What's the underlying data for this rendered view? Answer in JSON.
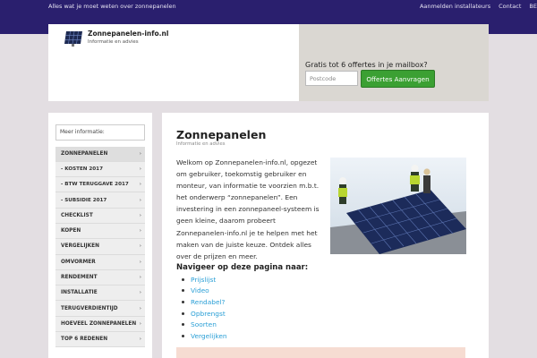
{
  "topbar": {
    "tagline": "Alles wat je moet weten over zonnepanelen",
    "links": [
      "Aanmelden installateurs",
      "Contact",
      "BE"
    ]
  },
  "header": {
    "site_title": "Zonnepanelen-info.nl",
    "site_subtitle": "Informatie en advies",
    "logo_icon": "solar-panel-icon",
    "cta_text": "Gratis tot 6 offertes in je mailbox?",
    "postcode_placeholder": "Postcode",
    "cta_button": "Offertes Aanvragen"
  },
  "sidebar": {
    "search_placeholder": "Meer informatie:",
    "items": [
      {
        "label": "ZONNEPANELEN"
      },
      {
        "label": "- KOSTEN 2017"
      },
      {
        "label": "- BTW TERUGGAVE 2017"
      },
      {
        "label": "- SUBSIDIE 2017"
      },
      {
        "label": "CHECKLIST"
      },
      {
        "label": "KOPEN"
      },
      {
        "label": "VERGELIJKEN"
      },
      {
        "label": "OMVORMER"
      },
      {
        "label": "RENDEMENT"
      },
      {
        "label": "INSTALLATIE"
      },
      {
        "label": "TERUGVERDIENTIJD"
      },
      {
        "label": "HOEVEEL ZONNEPANELEN"
      },
      {
        "label": "TOP 6 REDENEN"
      }
    ]
  },
  "content": {
    "title": "Zonnepanelen",
    "subtitle": "Informatie en advies",
    "intro": "Welkom op Zonnepanelen-info.nl, opgezet om gebruiker, toekomstig gebruiker en monteur, van informatie te voorzien m.b.t. het onderwerp “zonnepanelen”. Een investering in een zonnepaneel-systeem is geen kleine, daarom probeert Zonnepanelen-info.nl je te helpen met het maken van de juiste keuze. Ontdek alles over de prijzen en meer.",
    "nav_heading": "Navigeer op deze pagina naar:",
    "nav_links": [
      "Prijslijst",
      "Video",
      "Rendabel?",
      "Opbrengst",
      "Soorten",
      "Vergelijken"
    ]
  },
  "colors": {
    "topbar": "#2a1f6e",
    "page_bg": "#e3dee2",
    "cta_button": "#3ba033",
    "link": "#2a9fd6"
  }
}
